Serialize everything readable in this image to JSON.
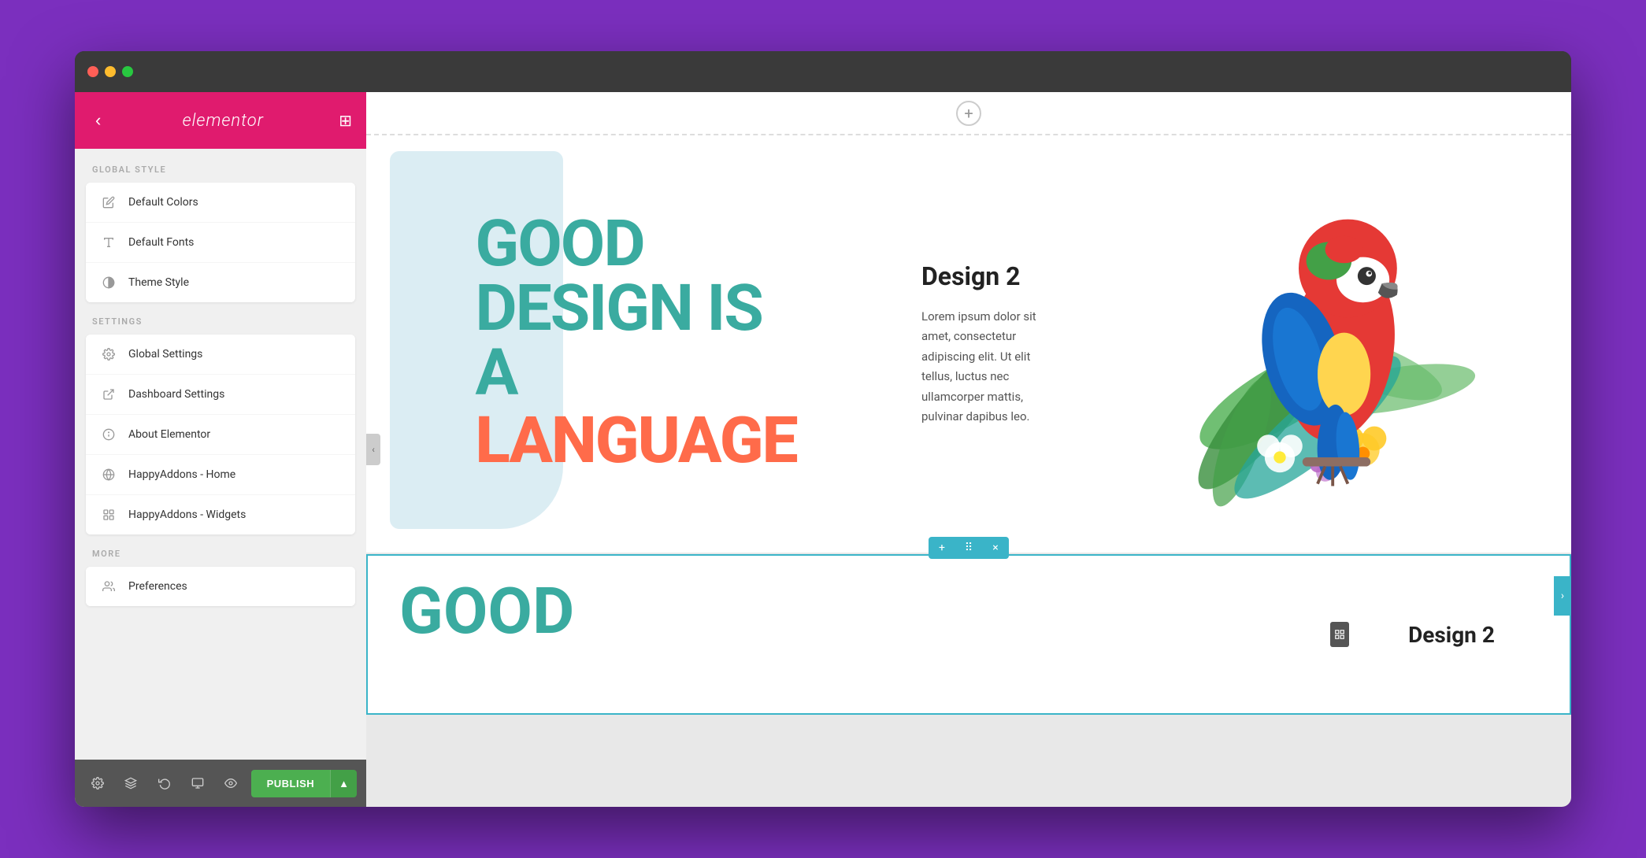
{
  "browser": {
    "traffic_lights": [
      "red",
      "yellow",
      "green"
    ]
  },
  "sidebar": {
    "header": {
      "back_label": "‹",
      "logo_text": "elementor",
      "grid_icon": "⊞"
    },
    "global_style_label": "GLOBAL STYLE",
    "global_style_items": [
      {
        "icon": "✏",
        "label": "Default Colors"
      },
      {
        "icon": "A",
        "label": "Default Fonts"
      },
      {
        "icon": "◑",
        "label": "Theme Style"
      }
    ],
    "settings_label": "SETTINGS",
    "settings_items": [
      {
        "icon": "⚙",
        "label": "Global Settings",
        "has_arrow": true
      },
      {
        "icon": "↗",
        "label": "Dashboard Settings"
      },
      {
        "icon": "ℹ",
        "label": "About Elementor"
      },
      {
        "icon": "🌐",
        "label": "HappyAddons - Home"
      },
      {
        "icon": "⊞",
        "label": "HappyAddons - Widgets"
      }
    ],
    "more_label": "MORE",
    "more_items": [
      {
        "icon": "👤",
        "label": "Preferences"
      }
    ],
    "footer": {
      "icons": [
        "⚙",
        "≡",
        "↩",
        "🖥",
        "👁"
      ],
      "publish_label": "PUBLISH",
      "dropdown_label": "▲"
    }
  },
  "canvas": {
    "add_section_icon": "+",
    "section1": {
      "headline": {
        "line1": "GOOD",
        "line2": "DESIGN IS",
        "line3": "A",
        "line4": "",
        "line5": "LANGUAGE"
      },
      "design2_title": "Design 2",
      "design2_body": "Lorem ipsum dolor sit amet, consectetur adipiscing elit. Ut elit tellus, luctus nec ullamcorper mattis, pulvinar dapibus leo."
    },
    "section2": {
      "headline": "GOOD",
      "title": "Design 2"
    },
    "section_toolbar": {
      "add_label": "+",
      "move_label": "⠿",
      "close_label": "×"
    }
  }
}
